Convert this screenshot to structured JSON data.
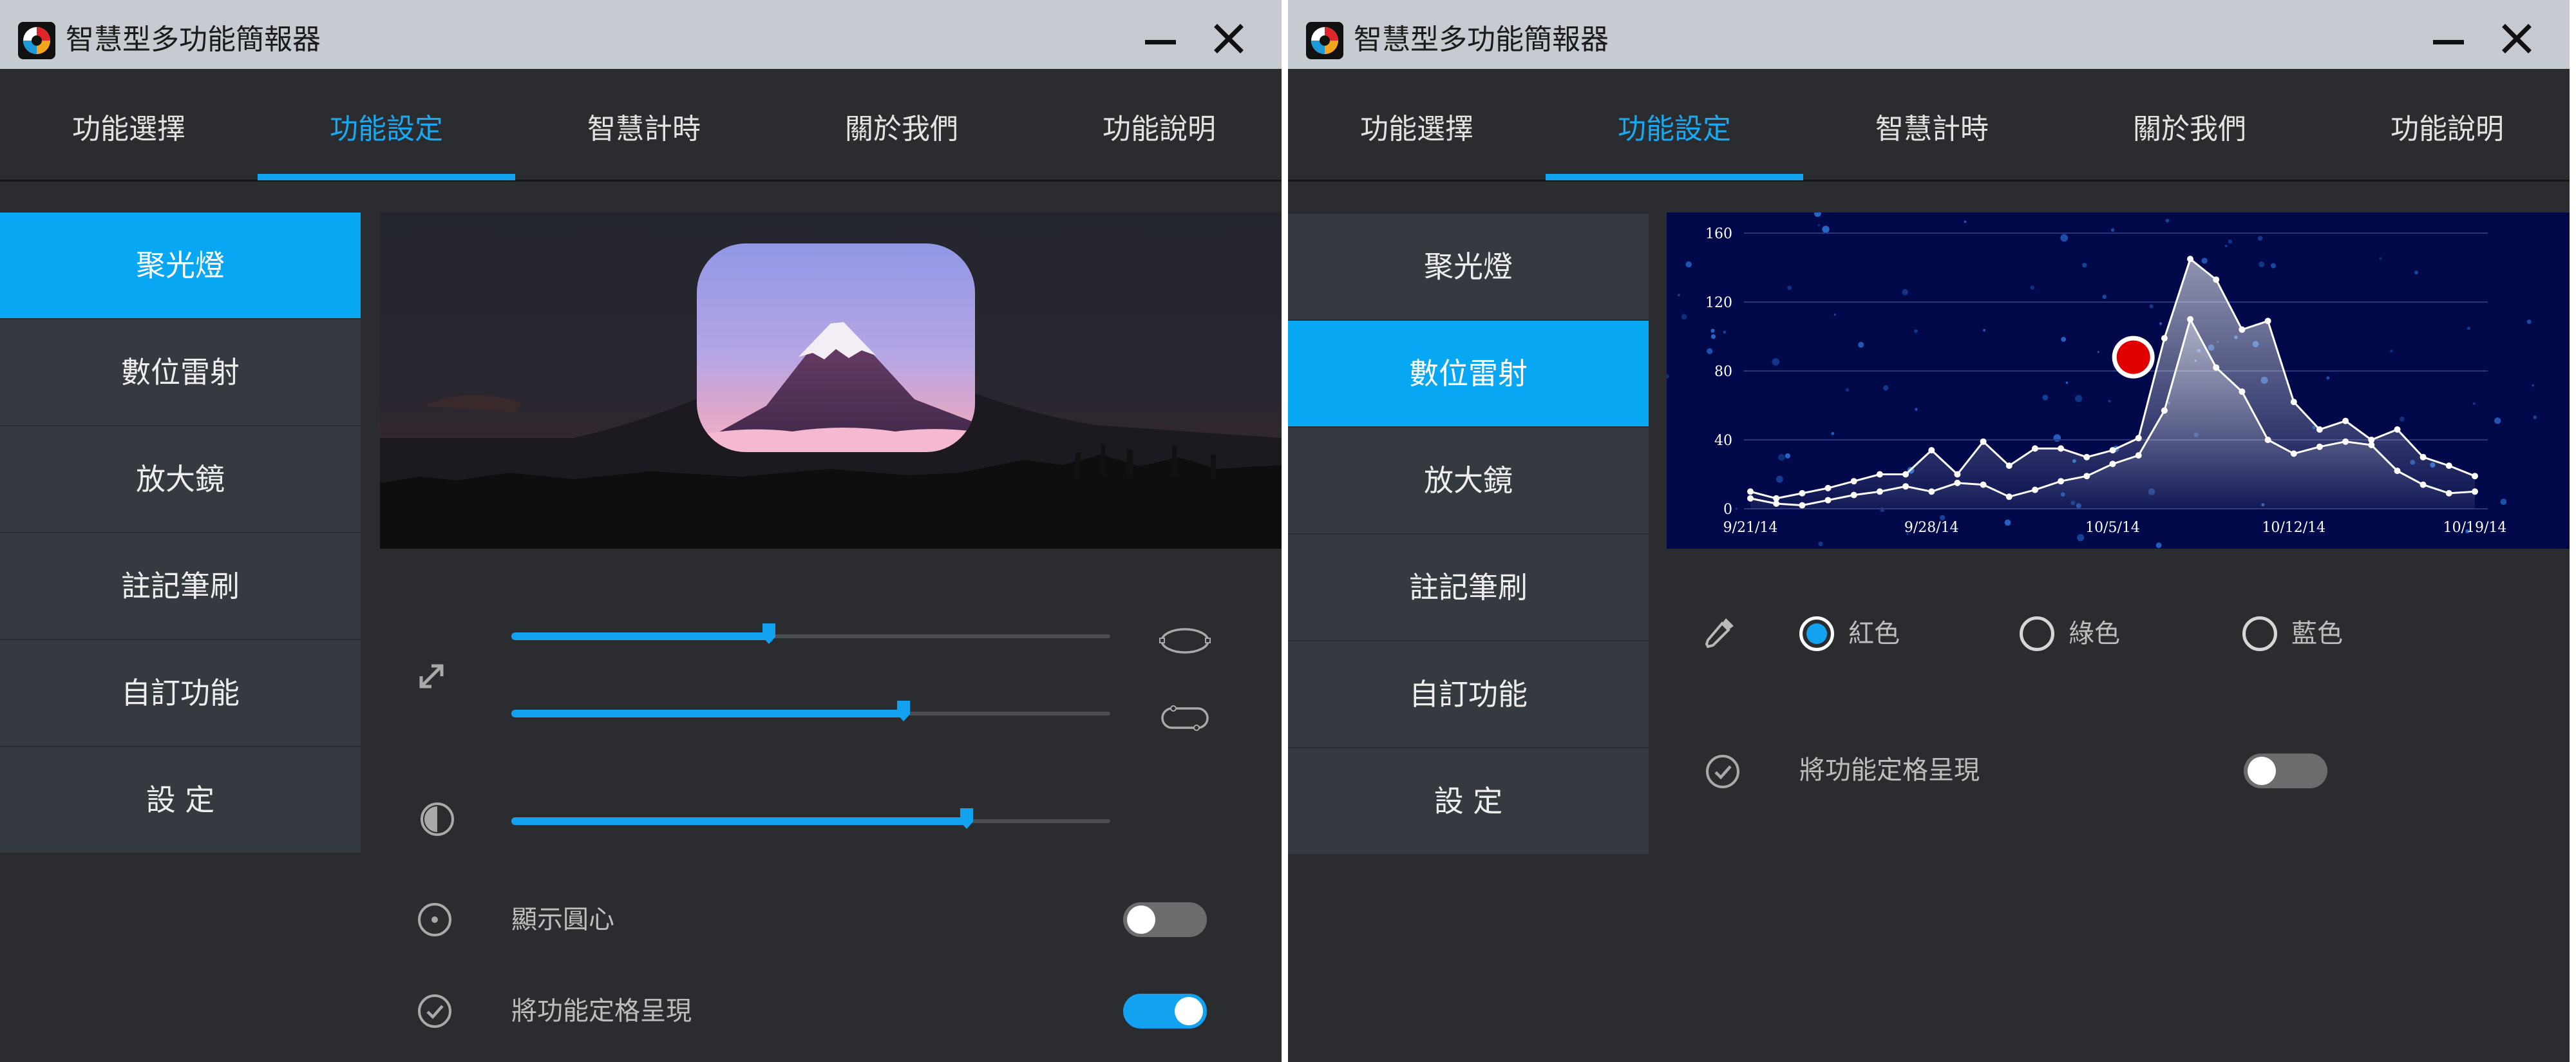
{
  "app_title": "智慧型多功能簡報器",
  "tabs": [
    "功能選擇",
    "功能設定",
    "智慧計時",
    "關於我們",
    "功能說明"
  ],
  "sidebar": [
    "聚光燈",
    "數位雷射",
    "放大鏡",
    "註記筆刷",
    "自訂功能",
    "設 定"
  ],
  "colors": {
    "accent": "#13a2ef",
    "sidebar_active": "#07a7f4",
    "window_bg": "#2b2c2f",
    "sidebar_bg": "#353a41",
    "titlebar_bg": "#c5cbd1",
    "laser_dot": "#e10000"
  },
  "left_panel": {
    "active_tab": "功能設定",
    "active_sidebar": "聚光燈",
    "sliders": [
      {
        "name": "spotlight-size",
        "value": 0.43
      },
      {
        "name": "spotlight-roundness",
        "value": 0.655
      },
      {
        "name": "background-dimming",
        "value": 0.76
      }
    ],
    "show_center_label": "顯示圓心",
    "show_center_on": false,
    "freeze_label": "將功能定格呈現",
    "freeze_on": true
  },
  "right_panel": {
    "active_tab": "功能設定",
    "active_sidebar": "數位雷射",
    "color_options": [
      "紅色",
      "綠色",
      "藍色"
    ],
    "selected_color": "紅色",
    "freeze_label": "將功能定格呈現",
    "freeze_on": false
  },
  "chart_data": {
    "type": "area",
    "x": [
      "9/21/14",
      "9/22/14",
      "9/23/14",
      "9/24/14",
      "9/25/14",
      "9/26/14",
      "9/27/14",
      "9/28/14",
      "9/29/14",
      "9/30/14",
      "10/1/14",
      "10/2/14",
      "10/3/14",
      "10/4/14",
      "10/5/14",
      "10/6/14",
      "10/7/14",
      "10/8/14",
      "10/9/14",
      "10/10/14",
      "10/11/14",
      "10/12/14",
      "10/13/14",
      "10/14/14",
      "10/15/14",
      "10/16/14",
      "10/17/14",
      "10/18/14",
      "10/19/14"
    ],
    "xticks": [
      "9/21/14",
      "9/28/14",
      "10/5/14",
      "10/12/14",
      "10/19/14"
    ],
    "yticks": [
      0,
      40,
      80,
      120,
      160
    ],
    "ylim": [
      0,
      160
    ],
    "series": [
      {
        "values": [
          10,
          6,
          9,
          12,
          16,
          20,
          20,
          34,
          20,
          39,
          25,
          35,
          35,
          30,
          34,
          41,
          99,
          145,
          133,
          104,
          109,
          62,
          46,
          51,
          40,
          46,
          30,
          25,
          19
        ]
      },
      {
        "values": [
          6,
          3,
          2,
          5,
          8,
          10,
          13,
          10,
          15,
          14,
          7,
          11,
          16,
          19,
          26,
          31,
          57,
          110,
          82,
          68,
          40,
          32,
          36,
          39,
          37,
          22,
          14,
          9,
          10
        ]
      }
    ],
    "laser_point": {
      "x": "10/6/14",
      "y": 88
    }
  }
}
